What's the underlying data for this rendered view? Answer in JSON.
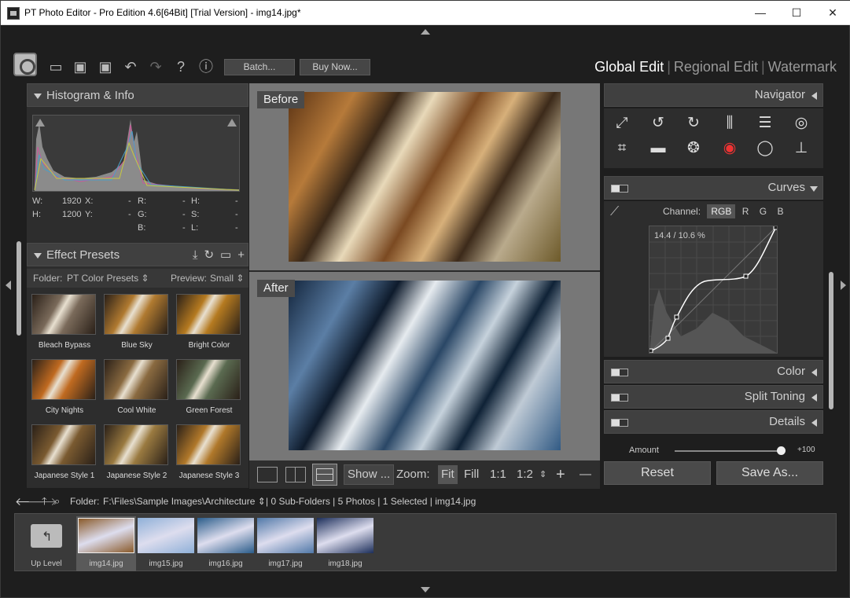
{
  "window": {
    "title": "PT Photo Editor - Pro Edition 4.6[64Bit] [Trial Version] - img14.jpg*",
    "minimize": "—",
    "maximize": "☐",
    "close": "✕"
  },
  "toolbar": {
    "batch_label": "Batch...",
    "buy_label": "Buy Now...",
    "help": "?",
    "info": "ⓘ"
  },
  "mode_tabs": [
    "Global Edit",
    "Regional Edit",
    "Watermark"
  ],
  "histogram": {
    "title": "Histogram & Info",
    "info": {
      "w_label": "W:",
      "w_value": "1920",
      "h_label": "H:",
      "h_value": "1200",
      "x_label": "X:",
      "x_value": "-",
      "y_label": "Y:",
      "y_value": "-",
      "r_label": "R:",
      "r_value": "-",
      "g_label": "G:",
      "g_value": "-",
      "b_label": "B:",
      "b_value": "-",
      "hh_label": "H:",
      "hh_value": "-",
      "s_label": "S:",
      "s_value": "-",
      "l_label": "L:",
      "l_value": "-"
    }
  },
  "presets": {
    "title": "Effect Presets",
    "folder_label": "Folder:",
    "folder_value": "PT Color Presets",
    "preview_label": "Preview:",
    "preview_value": "Small",
    "items": [
      {
        "label": "Bleach Bypass",
        "color": "#7a6a5a"
      },
      {
        "label": "Blue Sky",
        "color": "#b07a30"
      },
      {
        "label": "Bright Color",
        "color": "#b57a20"
      },
      {
        "label": "City Nights",
        "color": "#c06a20"
      },
      {
        "label": "Cool White",
        "color": "#8a6a40"
      },
      {
        "label": "Green Forest",
        "color": "#5a6a50"
      },
      {
        "label": "Japanese Style 1",
        "color": "#7a5a30"
      },
      {
        "label": "Japanese Style 2",
        "color": "#9a7a40"
      },
      {
        "label": "Japanese Style 3",
        "color": "#b0782a"
      }
    ]
  },
  "view": {
    "before_label": "Before",
    "after_label": "After"
  },
  "viewbar": {
    "show_label": "Show ...",
    "zoom_label": "Zoom:",
    "fit_label": "Fit",
    "fill_label": "Fill",
    "one_to_one": "1:1",
    "one_to_two": "1:2",
    "plus": "+",
    "minus": "—"
  },
  "right": {
    "navigator_title": "Navigator",
    "curves_title": "Curves",
    "color_title": "Color",
    "split_toning_title": "Split Toning",
    "details_title": "Details",
    "channel_label": "Channel:",
    "channels": [
      "RGB",
      "R",
      "G",
      "B"
    ],
    "curve_readout": "14.4 / 10.6 %",
    "amount_label": "Amount",
    "amount_value": "+100",
    "amount_fraction": 1.0,
    "reset_label": "Reset",
    "save_as_label": "Save As..."
  },
  "pathbar": {
    "folder_label": "Folder:",
    "folder_path": "F:\\Files\\Sample Images\\Architecture",
    "summary": "| 0 Sub-Folders | 5 Photos | 1 Selected | img14.jpg"
  },
  "filmstrip": {
    "up_level_label": "Up Level",
    "items": [
      {
        "name": "img14.jpg",
        "selected": true,
        "color": "#8a5a2a"
      },
      {
        "name": "img15.jpg",
        "selected": false,
        "color": "#8fb0d8"
      },
      {
        "name": "img16.jpg",
        "selected": false,
        "color": "#2a5c8a"
      },
      {
        "name": "img17.jpg",
        "selected": false,
        "color": "#5078a8"
      },
      {
        "name": "img18.jpg",
        "selected": false,
        "color": "#1c2e5a"
      }
    ]
  }
}
